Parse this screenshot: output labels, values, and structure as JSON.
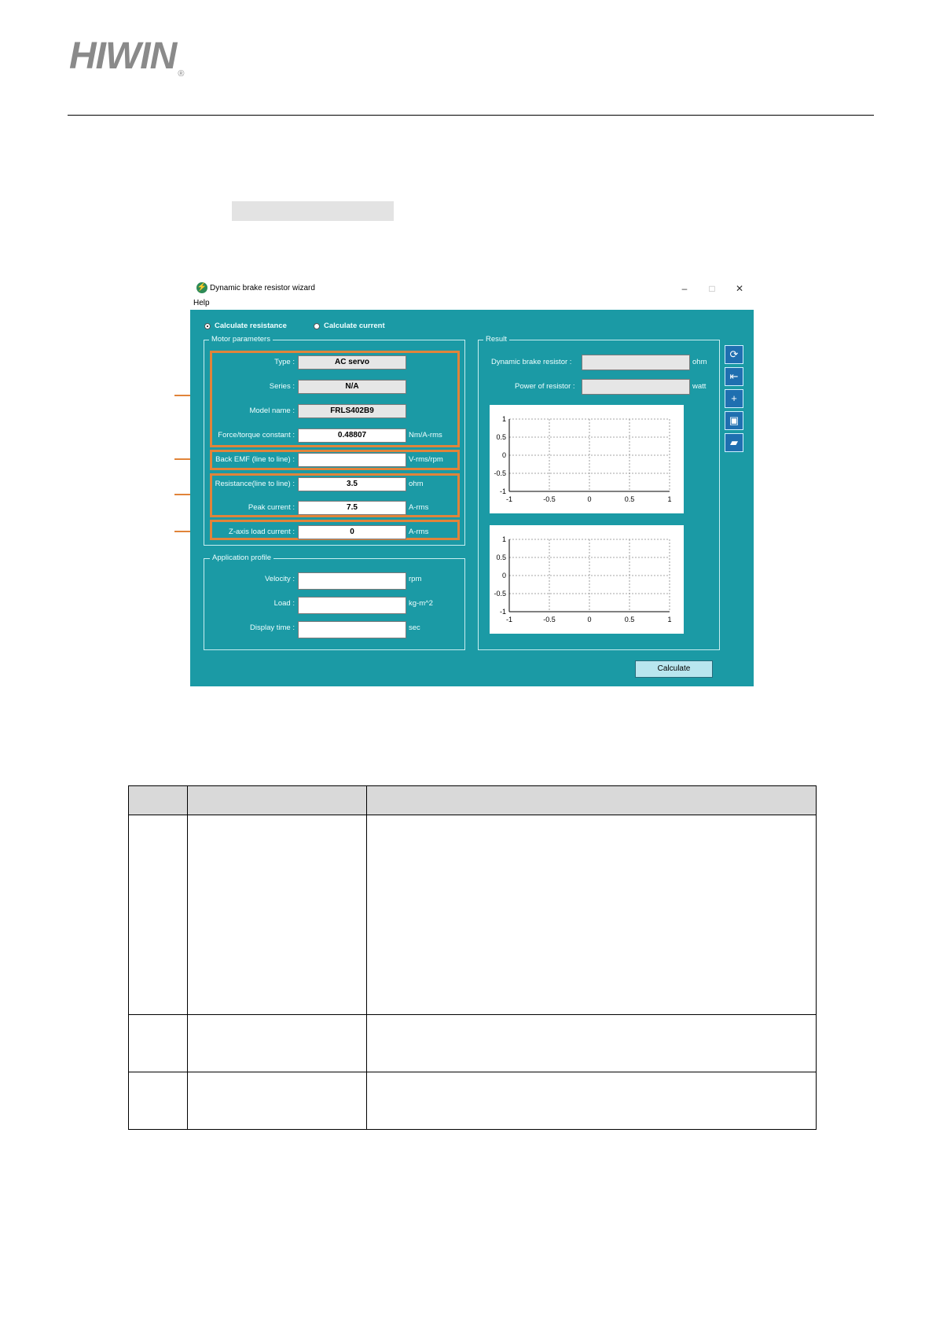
{
  "header": {
    "brand": "HIWIN",
    "registered": "®"
  },
  "window": {
    "title": "Dynamic brake resistor wizard",
    "controls": {
      "minimize": "–",
      "maximize": "□",
      "close": "✕"
    },
    "menu": [
      "Help"
    ],
    "mode": {
      "options": [
        "Calculate resistance",
        "Calculate current"
      ],
      "selected": "Calculate resistance"
    },
    "motor_parameters": {
      "title": "Motor parameters",
      "rows": [
        {
          "label": "Type :",
          "value": "AC servo",
          "unit": ""
        },
        {
          "label": "Series :",
          "value": "N/A",
          "unit": ""
        },
        {
          "label": "Model name :",
          "value": "FRLS402B9",
          "unit": ""
        },
        {
          "label": "Force/torque constant :",
          "value": "0.48807",
          "unit": "Nm/A-rms"
        },
        {
          "label": "Back EMF (line to line) :",
          "value": "",
          "unit": "V-rms/rpm"
        },
        {
          "label": "Resistance(line to line) :",
          "value": "3.5",
          "unit": "ohm"
        },
        {
          "label": "Peak current :",
          "value": "7.5",
          "unit": "A-rms"
        },
        {
          "label": "Z-axis load current :",
          "value": "0",
          "unit": "A-rms"
        }
      ]
    },
    "application_profile": {
      "title": "Application profile",
      "rows": [
        {
          "label": "Velocity :",
          "value": "",
          "unit": "rpm"
        },
        {
          "label": "Load :",
          "value": "",
          "unit": "kg-m^2"
        },
        {
          "label": "Display time :",
          "value": "",
          "unit": "sec"
        }
      ]
    },
    "result": {
      "title": "Result",
      "rows": [
        {
          "label": "Dynamic brake resistor :",
          "value": "",
          "unit": "ohm"
        },
        {
          "label": "Power of resistor :",
          "value": "",
          "unit": "watt"
        }
      ]
    },
    "toolbar_icons": [
      "refresh-icon",
      "import-icon",
      "add-icon",
      "save-icon",
      "open-folder-icon"
    ],
    "calculate_label": "Calculate"
  },
  "chart_data": [
    {
      "type": "line",
      "x": [],
      "y": [],
      "title": "",
      "xlabel": "",
      "ylabel": "",
      "xlim": [
        -1,
        1
      ],
      "ylim": [
        -1,
        1
      ],
      "xticks": [
        "-1",
        "-0.5",
        "0",
        "0.5",
        "1"
      ],
      "yticks": [
        "1",
        "0.5",
        "0",
        "-0.5",
        "-1"
      ],
      "grid": true
    },
    {
      "type": "line",
      "x": [],
      "y": [],
      "title": "",
      "xlabel": "",
      "ylabel": "",
      "xlim": [
        -1,
        1
      ],
      "ylim": [
        -1,
        1
      ],
      "xticks": [
        "-1",
        "-0.5",
        "0",
        "0.5",
        "1"
      ],
      "yticks": [
        "1",
        "0.5",
        "0",
        "-0.5",
        "-1"
      ],
      "grid": true
    }
  ],
  "table": {
    "header": [
      "",
      "",
      ""
    ],
    "rows": [
      [
        "",
        "",
        ""
      ],
      [
        "",
        "",
        ""
      ],
      [
        "",
        "",
        ""
      ]
    ]
  }
}
